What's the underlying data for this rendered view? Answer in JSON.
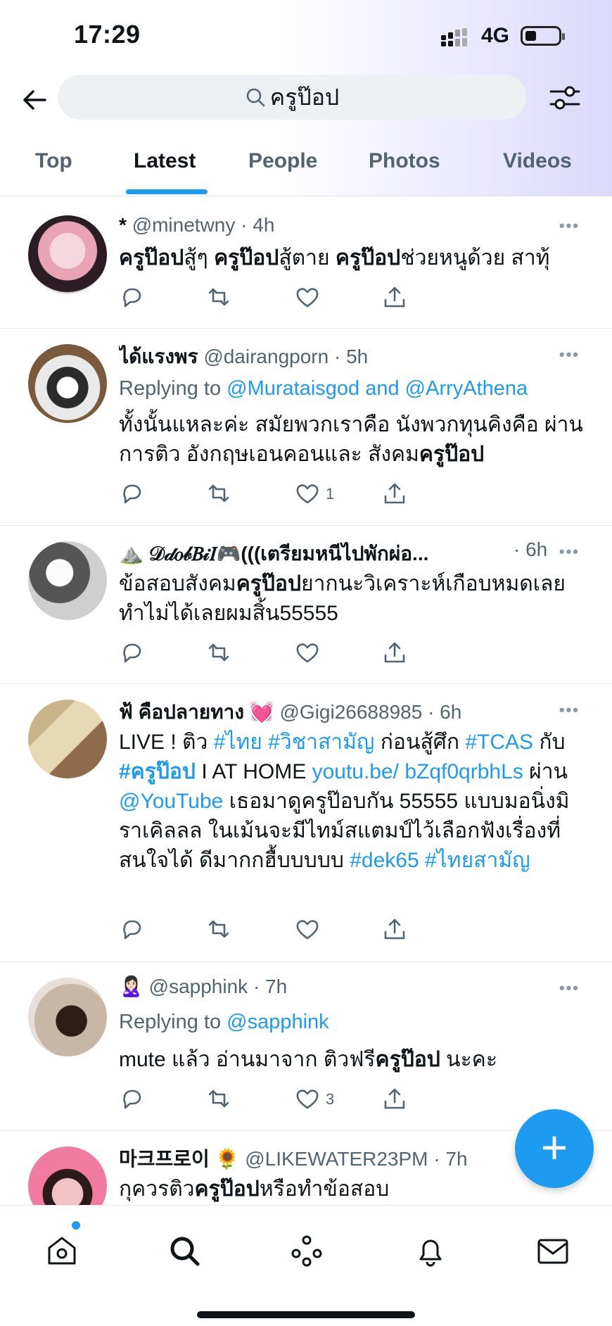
{
  "status_bar": {
    "time": "17:29",
    "network": "4G"
  },
  "search": {
    "query": "ครูป๊อป"
  },
  "tabs": [
    {
      "label": "Top"
    },
    {
      "label": "Latest"
    },
    {
      "label": "People"
    },
    {
      "label": "Photos"
    },
    {
      "label": "Videos"
    }
  ],
  "active_tab": "Latest",
  "tweets": [
    {
      "name": "*",
      "handle": "@minetwny",
      "time": "· 4h",
      "text_parts": [
        {
          "t": "ครูป๊อป",
          "b": true
        },
        {
          "t": "สู้ๆ "
        },
        {
          "t": "ครูป๊อป",
          "b": true
        },
        {
          "t": "สู้ตาย "
        },
        {
          "t": "ครูป๊อป",
          "b": true
        },
        {
          "t": "ช่วยหนูด้วย สาทุ้"
        }
      ]
    },
    {
      "name": "ได้แรงพร",
      "handle": "@dairangporn",
      "time": "· 5h",
      "replying": {
        "prefix": "Replying to ",
        "to": "@Murataisgod and @ArryAthena"
      },
      "text_parts": [
        {
          "t": "ทั้งนั้นแหละค่ะ สมัยพวกเราคือ นังพวกทุนคิงคือ ผ่านการติว อังกฤษเอนคอนและ สังคม"
        },
        {
          "t": "ครูป๊อป",
          "b": true
        }
      ],
      "likes": "1"
    },
    {
      "name": "⛰️ 𝒟𝒹𝑜𝒷𝐵𝒾𝐼🎮(((เตรียมหนีไปพักผ่อ...",
      "handle": "",
      "time": "· 6h",
      "text_parts": [
        {
          "t": "ข้อสอบสังคม"
        },
        {
          "t": "ครูป๊อป",
          "b": true
        },
        {
          "t": "ยากนะวิเคราะห์เกือบหมดเลย ทำไม่ได้เลยผมสิ้น55555"
        }
      ]
    },
    {
      "name": "ฟ้ คือปลายทาง 💓",
      "handle": "@Gigi26688985",
      "time": "· 6h",
      "text_parts": [
        {
          "t": "LIVE ! ติว "
        },
        {
          "t": "#ไทย",
          "l": true
        },
        {
          "t": " "
        },
        {
          "t": "#วิชาสามัญ",
          "l": true
        },
        {
          "t": " ก่อนสู้ศึก "
        },
        {
          "t": "#TCAS",
          "l": true
        },
        {
          "t": " กับ "
        },
        {
          "t": "#ครูป๊อป",
          "l": true,
          "b": true
        },
        {
          "t": " I AT HOME "
        },
        {
          "t": "youtu.be/ bZqf0qrbhLs",
          "l": true
        },
        {
          "t": " ผ่าน "
        },
        {
          "t": "@YouTube",
          "l": true
        },
        {
          "t": " เธอมาดูครูป๊อบกัน 55555 แบบมอนิ่งมิราเคิลลล ในเม้นจะมีไทม์สแตมป์ไว้เลือกฟังเรื่องที่สนใจได้ ดีมากกฮื้บบบบบ "
        },
        {
          "t": "#dek65",
          "l": true
        },
        {
          "t": " "
        },
        {
          "t": "#ไทยสามัญ",
          "l": true
        }
      ]
    },
    {
      "name": "🙎🏻‍♀️",
      "handle": "@sapphink",
      "time": "· 7h",
      "replying": {
        "prefix": "Replying to ",
        "to": "@sapphink"
      },
      "text_parts": [
        {
          "t": "mute แล้ว อ่านมาจาก ติวฟรี"
        },
        {
          "t": "ครูป๊อป",
          "b": true
        },
        {
          "t": " นะคะ"
        }
      ],
      "likes": "3"
    },
    {
      "name": "마크프로이 🌻",
      "handle": "@LIKEWATER23PM",
      "time": "· 7h",
      "text_parts": [
        {
          "t": "กุควรติว"
        },
        {
          "t": "ครูป๊อป",
          "b": true
        },
        {
          "t": "หรือทำข้อสอบ"
        }
      ]
    }
  ],
  "colors": {
    "accent": "#1d9bf0",
    "text": "#0f1419",
    "muted": "#536471"
  },
  "icons": [
    "back-arrow-icon",
    "search-icon",
    "filter-icon",
    "reply-icon",
    "retweet-icon",
    "like-icon",
    "share-icon",
    "compose-icon",
    "home-icon",
    "search-nav-icon",
    "spaces-icon",
    "bell-icon",
    "mail-icon"
  ]
}
